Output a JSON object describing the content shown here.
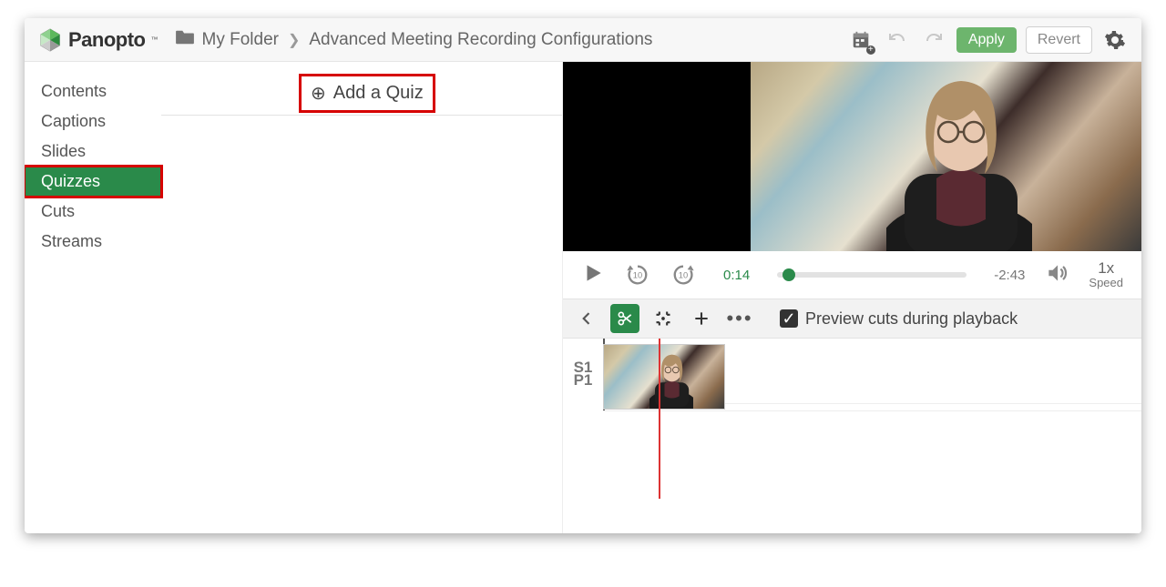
{
  "brand": {
    "name": "Panopto"
  },
  "breadcrumb": {
    "folder": "My Folder",
    "title": "Advanced Meeting Recording Configurations"
  },
  "toolbar": {
    "apply": "Apply",
    "revert": "Revert"
  },
  "sidebar": {
    "items": [
      {
        "label": "Contents"
      },
      {
        "label": "Captions"
      },
      {
        "label": "Slides"
      },
      {
        "label": "Quizzes"
      },
      {
        "label": "Cuts"
      },
      {
        "label": "Streams"
      }
    ],
    "active_index": 3
  },
  "content_actions": {
    "add_quiz": "Add a Quiz"
  },
  "player": {
    "position": "0:14",
    "remaining": "-2:43",
    "speed_value": "1x",
    "speed_label": "Speed",
    "skip_back_seconds": "10",
    "skip_fwd_seconds": "10"
  },
  "timeline_tools": {
    "preview_label": "Preview cuts during playback",
    "preview_checked": true
  },
  "timeline": {
    "tracks": [
      {
        "id": "P1",
        "label": "P1"
      },
      {
        "id": "S1",
        "label": "S1"
      }
    ]
  }
}
